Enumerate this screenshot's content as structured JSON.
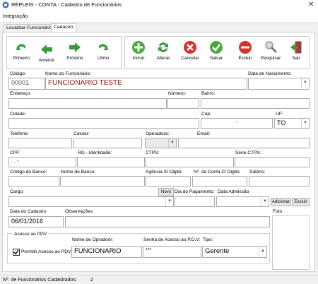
{
  "window": {
    "title": "RÉPLEIS - CONTA - Cadastro de Funcionários",
    "close_glyph": "✕"
  },
  "menu": {
    "items": [
      "Integração"
    ]
  },
  "tabs": [
    "Localizar Funcionário",
    "Cadastro"
  ],
  "toolbar": {
    "nav": [
      "Primeiro",
      "Anterior",
      "Próximo",
      "Ultmo"
    ],
    "actions": [
      "Incluir",
      "Alterar",
      "Cancelar",
      "Salvar",
      "Excluir",
      "Pesquisar",
      "Sair"
    ]
  },
  "labels": {
    "codigo": "Código:",
    "nome": "Nome do Funcionário:",
    "nascimento": "Data de Nascimento:",
    "endereco": "Endereço:",
    "numero": "Número:",
    "bairro": "Bairro:",
    "cidade": "Cidade:",
    "cep": "Cep:",
    "uf": "UF:",
    "telefone": "Telefone:",
    "celular": "Celular:",
    "operadora": "Operadora:",
    "email": "Email:",
    "cpf": "CPF:",
    "rg": "RG - Identidade:",
    "ctps": "CTPS:",
    "serie": "Série CTPS:",
    "cod_banco": "Código do Banco:",
    "nome_banco": "Nome do Banco:",
    "agencia": "Agência S/ Digito:",
    "conta": "Nº. da Conta C/ Digito:",
    "salario": "Salário:",
    "cargo": "Cargo:",
    "dia_pag": "Dia do Pagamento:",
    "admissao": "Data Admissão",
    "data_cadastro": "Data do Cadastro",
    "obs": "Observações:",
    "foto": "Foto",
    "acesso": "Acesso ao PDV",
    "operador": "Nome de Opradoor:",
    "senha": "Senha de Acesso ao P.D.V:",
    "tipo": "Tipo:",
    "permitir": "Permitir Acesso ao PDV"
  },
  "values": {
    "codigo": "00001",
    "nome": "FUNCIONARIO TESTE",
    "cep": "-",
    "uf": "TO",
    "cpf": ". . -",
    "data_cadastro": "06/01/2016",
    "operador": "FUNCIONARIO",
    "senha": "***",
    "tipo": "Gerente"
  },
  "buttons": {
    "novo": "Novo",
    "adicionar": "Adicionar",
    "excluir": "Excluir"
  },
  "status": {
    "label": "Nº. de Funcionários Cadastrados:",
    "count": "2"
  },
  "colors": {
    "green": "#3a9a3a",
    "red": "#d9302c",
    "name_text": "#8b1a1a"
  }
}
